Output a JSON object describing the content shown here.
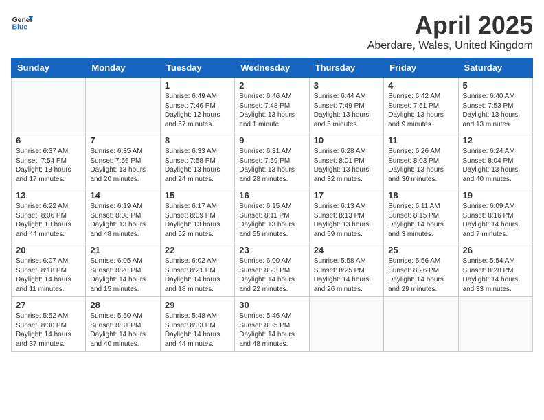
{
  "logo": {
    "general": "General",
    "blue": "Blue"
  },
  "title": "April 2025",
  "subtitle": "Aberdare, Wales, United Kingdom",
  "days_of_week": [
    "Sunday",
    "Monday",
    "Tuesday",
    "Wednesday",
    "Thursday",
    "Friday",
    "Saturday"
  ],
  "weeks": [
    [
      {
        "day": "",
        "info": ""
      },
      {
        "day": "",
        "info": ""
      },
      {
        "day": "1",
        "info": "Sunrise: 6:49 AM\nSunset: 7:46 PM\nDaylight: 12 hours and 57 minutes."
      },
      {
        "day": "2",
        "info": "Sunrise: 6:46 AM\nSunset: 7:48 PM\nDaylight: 13 hours and 1 minute."
      },
      {
        "day": "3",
        "info": "Sunrise: 6:44 AM\nSunset: 7:49 PM\nDaylight: 13 hours and 5 minutes."
      },
      {
        "day": "4",
        "info": "Sunrise: 6:42 AM\nSunset: 7:51 PM\nDaylight: 13 hours and 9 minutes."
      },
      {
        "day": "5",
        "info": "Sunrise: 6:40 AM\nSunset: 7:53 PM\nDaylight: 13 hours and 13 minutes."
      }
    ],
    [
      {
        "day": "6",
        "info": "Sunrise: 6:37 AM\nSunset: 7:54 PM\nDaylight: 13 hours and 17 minutes."
      },
      {
        "day": "7",
        "info": "Sunrise: 6:35 AM\nSunset: 7:56 PM\nDaylight: 13 hours and 20 minutes."
      },
      {
        "day": "8",
        "info": "Sunrise: 6:33 AM\nSunset: 7:58 PM\nDaylight: 13 hours and 24 minutes."
      },
      {
        "day": "9",
        "info": "Sunrise: 6:31 AM\nSunset: 7:59 PM\nDaylight: 13 hours and 28 minutes."
      },
      {
        "day": "10",
        "info": "Sunrise: 6:28 AM\nSunset: 8:01 PM\nDaylight: 13 hours and 32 minutes."
      },
      {
        "day": "11",
        "info": "Sunrise: 6:26 AM\nSunset: 8:03 PM\nDaylight: 13 hours and 36 minutes."
      },
      {
        "day": "12",
        "info": "Sunrise: 6:24 AM\nSunset: 8:04 PM\nDaylight: 13 hours and 40 minutes."
      }
    ],
    [
      {
        "day": "13",
        "info": "Sunrise: 6:22 AM\nSunset: 8:06 PM\nDaylight: 13 hours and 44 minutes."
      },
      {
        "day": "14",
        "info": "Sunrise: 6:19 AM\nSunset: 8:08 PM\nDaylight: 13 hours and 48 minutes."
      },
      {
        "day": "15",
        "info": "Sunrise: 6:17 AM\nSunset: 8:09 PM\nDaylight: 13 hours and 52 minutes."
      },
      {
        "day": "16",
        "info": "Sunrise: 6:15 AM\nSunset: 8:11 PM\nDaylight: 13 hours and 55 minutes."
      },
      {
        "day": "17",
        "info": "Sunrise: 6:13 AM\nSunset: 8:13 PM\nDaylight: 13 hours and 59 minutes."
      },
      {
        "day": "18",
        "info": "Sunrise: 6:11 AM\nSunset: 8:15 PM\nDaylight: 14 hours and 3 minutes."
      },
      {
        "day": "19",
        "info": "Sunrise: 6:09 AM\nSunset: 8:16 PM\nDaylight: 14 hours and 7 minutes."
      }
    ],
    [
      {
        "day": "20",
        "info": "Sunrise: 6:07 AM\nSunset: 8:18 PM\nDaylight: 14 hours and 11 minutes."
      },
      {
        "day": "21",
        "info": "Sunrise: 6:05 AM\nSunset: 8:20 PM\nDaylight: 14 hours and 15 minutes."
      },
      {
        "day": "22",
        "info": "Sunrise: 6:02 AM\nSunset: 8:21 PM\nDaylight: 14 hours and 18 minutes."
      },
      {
        "day": "23",
        "info": "Sunrise: 6:00 AM\nSunset: 8:23 PM\nDaylight: 14 hours and 22 minutes."
      },
      {
        "day": "24",
        "info": "Sunrise: 5:58 AM\nSunset: 8:25 PM\nDaylight: 14 hours and 26 minutes."
      },
      {
        "day": "25",
        "info": "Sunrise: 5:56 AM\nSunset: 8:26 PM\nDaylight: 14 hours and 29 minutes."
      },
      {
        "day": "26",
        "info": "Sunrise: 5:54 AM\nSunset: 8:28 PM\nDaylight: 14 hours and 33 minutes."
      }
    ],
    [
      {
        "day": "27",
        "info": "Sunrise: 5:52 AM\nSunset: 8:30 PM\nDaylight: 14 hours and 37 minutes."
      },
      {
        "day": "28",
        "info": "Sunrise: 5:50 AM\nSunset: 8:31 PM\nDaylight: 14 hours and 40 minutes."
      },
      {
        "day": "29",
        "info": "Sunrise: 5:48 AM\nSunset: 8:33 PM\nDaylight: 14 hours and 44 minutes."
      },
      {
        "day": "30",
        "info": "Sunrise: 5:46 AM\nSunset: 8:35 PM\nDaylight: 14 hours and 48 minutes."
      },
      {
        "day": "",
        "info": ""
      },
      {
        "day": "",
        "info": ""
      },
      {
        "day": "",
        "info": ""
      }
    ]
  ]
}
